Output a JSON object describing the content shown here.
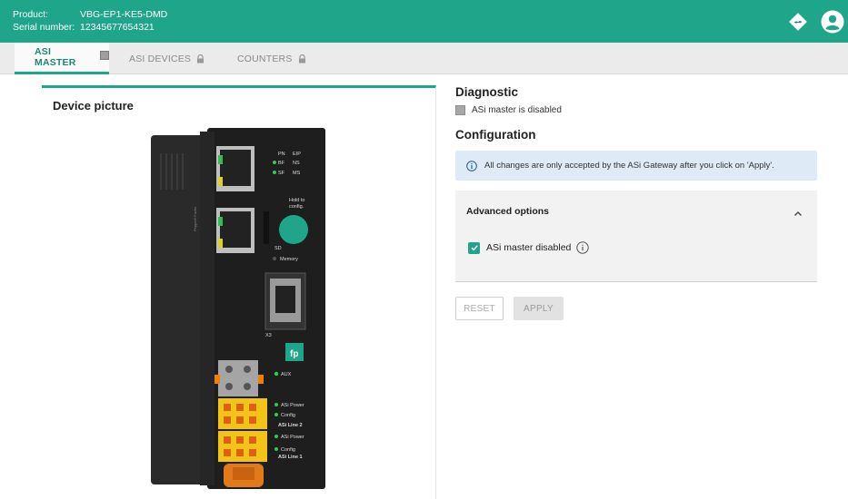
{
  "header": {
    "product_label": "Product:",
    "product_value": "VBG-EP1-KE5-DMD",
    "serial_label": "Serial number:",
    "serial_value": "12345677654321",
    "brand_color": "#1fa68a",
    "icons": [
      "network-diamond-icon",
      "user-avatar-icon"
    ]
  },
  "tabs": [
    {
      "label": "ASI MASTER",
      "active": true,
      "icon": "status-square-icon"
    },
    {
      "label": "ASI DEVICES",
      "active": false,
      "icon": "lock-icon"
    },
    {
      "label": "COUNTERS",
      "active": false,
      "icon": "lock-icon"
    }
  ],
  "left": {
    "title": "Device picture",
    "device": {
      "led_labels": {
        "pn": "PN",
        "eip": "EIP",
        "bf": "BF",
        "ns": "NS",
        "sf": "SF",
        "ms": "MS",
        "hold": "Hold to",
        "config": "config.",
        "sd": "SD",
        "memory": "Memory",
        "x3": "X3",
        "aux": "AUX",
        "asi_power_2": "ASi Power",
        "config_2": "Config",
        "line2": "ASi Line 2",
        "asi_power_1": "ASi Power",
        "config_1": "Config",
        "line1": "ASi Line 1"
      }
    }
  },
  "right": {
    "diagnostic_title": "Diagnostic",
    "diagnostic_text": "ASi master is disabled",
    "config_title": "Configuration",
    "info_text": "All changes are only accepted by the ASi Gateway after you click on 'Apply'.",
    "advanced_title": "Advanced options",
    "checkbox_label": "ASi master disabled",
    "checkbox_checked": true,
    "reset_label": "RESET",
    "apply_label": "APPLY"
  }
}
